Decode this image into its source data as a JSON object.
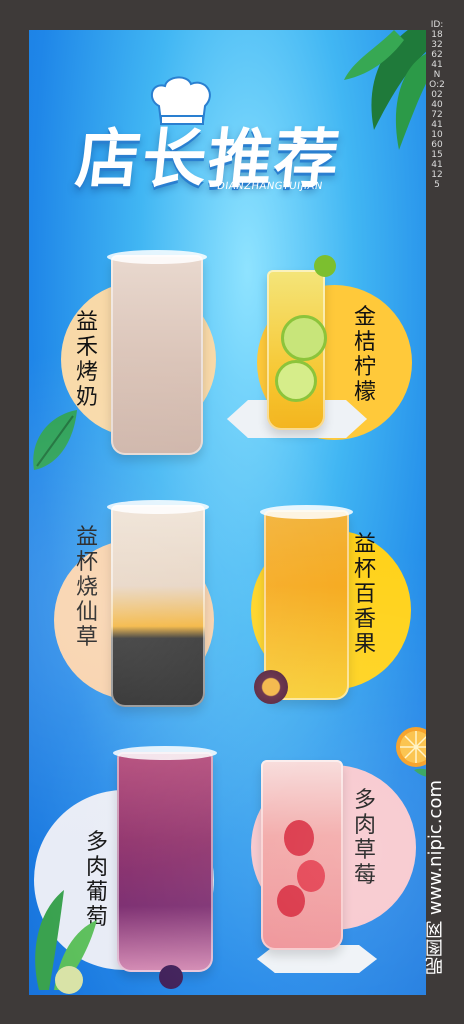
{
  "poster": {
    "title": "店长推荐",
    "subtitle": "DIANZHANGTUIJIAN"
  },
  "side_id": "ID:18326241 NO:20240724110601541125",
  "watermark": "昵图网 www.nipic.com",
  "drinks": [
    {
      "name": "益禾烤奶",
      "accent": "#f8d9a8"
    },
    {
      "name": "金桔柠檬",
      "accent": "#ffc93a"
    },
    {
      "name": "益杯烧仙草",
      "accent": "#f8d0a8"
    },
    {
      "name": "益杯百香果",
      "accent": "#ffd21a"
    },
    {
      "name": "多肉葡萄",
      "accent": "#e8ecf6"
    },
    {
      "name": "多肉草莓",
      "accent": "#f7c6cc"
    }
  ],
  "colors": {
    "background_frame": "#3e3a39",
    "poster_blue": "#2f9cee",
    "title_white": "#ffffff"
  }
}
